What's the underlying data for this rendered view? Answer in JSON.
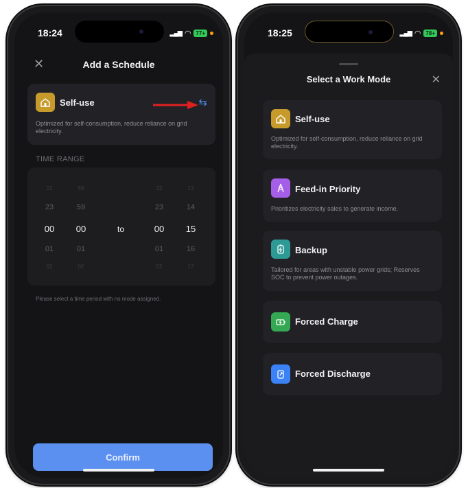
{
  "left_phone": {
    "status": {
      "time": "18:24",
      "battery": "77+"
    },
    "header": {
      "close_icon": "close-icon",
      "title": "Add a Schedule"
    },
    "selected_mode": {
      "name": "Self-use",
      "description": "Optimized for self-consumption, reduce reliance on grid electricity.",
      "icon": "house-icon",
      "switch_icon": "swap-arrows-icon"
    },
    "time_range": {
      "label": "TIME RANGE",
      "start_hours": [
        "22",
        "23",
        "00",
        "01",
        "02"
      ],
      "start_minutes": [
        "58",
        "59",
        "00",
        "01",
        "02"
      ],
      "separator": "to",
      "end_hours": [
        "22",
        "23",
        "00",
        "01",
        "02"
      ],
      "end_minutes": [
        "13",
        "14",
        "15",
        "16",
        "17"
      ],
      "hint": "Please select a time period with no mode assigned."
    },
    "confirm_label": "Confirm"
  },
  "right_phone": {
    "status": {
      "time": "18:25",
      "battery": "78+"
    },
    "sheet": {
      "title": "Select a Work Mode",
      "close_icon": "close-icon",
      "modes": [
        {
          "name": "Self-use",
          "description": "Optimized for self-consumption, reduce reliance on grid electricity.",
          "icon": "house-icon",
          "color": "#c79a2c"
        },
        {
          "name": "Feed-in Priority",
          "description": "Prioritizes electricity sales to generate income.",
          "icon": "power-tower-icon",
          "color": "#a55ee8"
        },
        {
          "name": "Backup",
          "description": "Tailored for areas with unstable power grids; Reserves SOC to prevent power outages.",
          "icon": "backup-battery-icon",
          "color": "#2d9a96"
        },
        {
          "name": "Forced Charge",
          "description": "",
          "icon": "battery-charge-icon",
          "color": "#34a853"
        },
        {
          "name": "Forced Discharge",
          "description": "",
          "icon": "discharge-icon",
          "color": "#3b82f6"
        }
      ]
    }
  },
  "colors": {
    "accent": "#5b8ff0",
    "annotation_arrow": "#e02020",
    "switch": "#4a8ef2"
  }
}
